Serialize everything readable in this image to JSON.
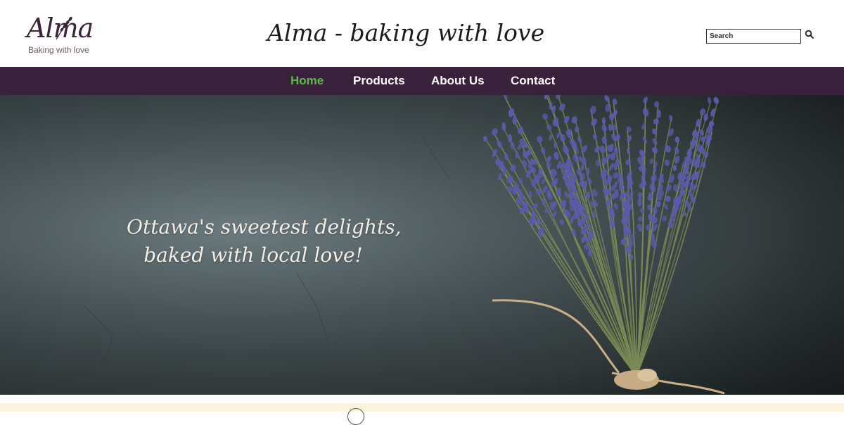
{
  "header": {
    "logo": {
      "mark": "Alma",
      "tagline": "Baking with love"
    },
    "site_title": "Alma - baking with love",
    "search": {
      "placeholder": "Search",
      "value": ""
    }
  },
  "nav": {
    "items": [
      {
        "label": "Home",
        "active": true
      },
      {
        "label": "Products",
        "active": false
      },
      {
        "label": "About Us",
        "active": false
      },
      {
        "label": "Contact",
        "active": false
      }
    ]
  },
  "hero": {
    "line1": "Ottawa's sweetest delights,",
    "line2": "baked with local love!"
  },
  "colors": {
    "nav_background": "#3a213b",
    "nav_active": "#5dbb4c",
    "nav_text": "#ffffff",
    "footer_band": "#fbf5dc",
    "lavender": "#5a5aa8"
  },
  "icons": {
    "search": "search-icon",
    "logo_sprig": "lavender-sprig-icon"
  }
}
